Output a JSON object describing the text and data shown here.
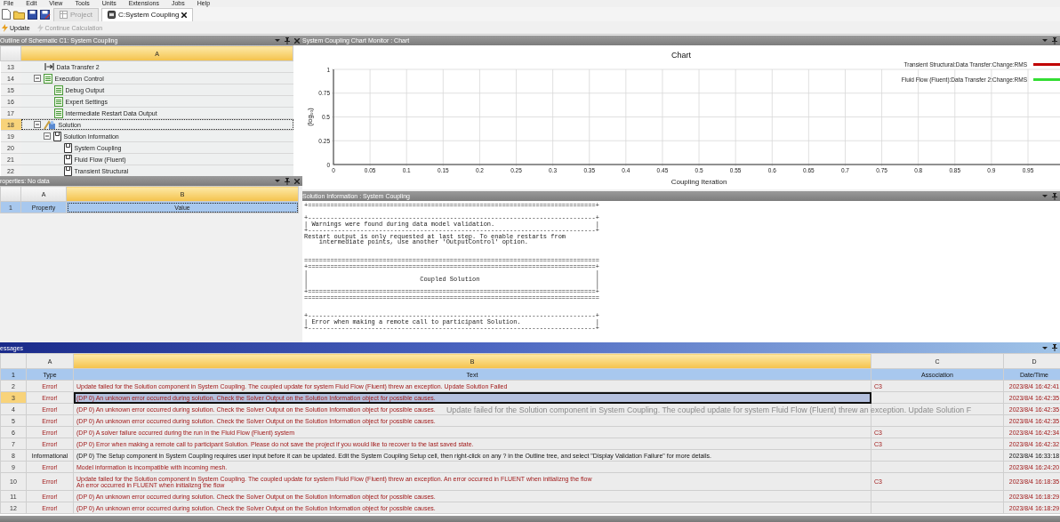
{
  "menu": [
    "File",
    "Edit",
    "View",
    "Tools",
    "Units",
    "Extensions",
    "Jobs",
    "Help"
  ],
  "tabs": [
    {
      "label": "Project",
      "selected": false
    },
    {
      "label": "C:System Coupling",
      "selected": true
    }
  ],
  "toolbar": [
    {
      "label": "Update",
      "disabled": false
    },
    {
      "label": "Continue Calculation",
      "disabled": true
    }
  ],
  "outline": {
    "title": "Outline of Schematic C1: System Coupling",
    "columns": [
      {
        "letter": "A",
        "selected": true
      }
    ],
    "items": [
      {
        "row": "13",
        "label": "Data Transfer 2",
        "kind": "transfer",
        "selected": false
      },
      {
        "row": "14",
        "label": "Execution Control",
        "kind": "settings",
        "expanded": true,
        "selected": false,
        "children": [
          {
            "row": "15",
            "label": "Debug Output",
            "kind": "settings",
            "selected": false
          },
          {
            "row": "16",
            "label": "Expert Settings",
            "kind": "settings",
            "selected": false
          },
          {
            "row": "17",
            "label": "Intermediate Restart Data Output",
            "kind": "settings",
            "selected": false
          }
        ]
      },
      {
        "row": "18",
        "label": "Solution",
        "kind": "solution",
        "expanded": true,
        "selected": true,
        "children": [
          {
            "row": "19",
            "label": "Solution Information",
            "kind": "info",
            "expanded": true,
            "selected": false,
            "children": [
              {
                "row": "20",
                "label": "System Coupling",
                "kind": "info",
                "selected": false
              },
              {
                "row": "21",
                "label": "Fluid Flow (Fluent)",
                "kind": "info",
                "selected": false
              },
              {
                "row": "22",
                "label": "Transient Structural",
                "kind": "info",
                "selected": false
              }
            ]
          }
        ]
      }
    ]
  },
  "properties": {
    "title": "roperties: No data",
    "columns": [
      {
        "letter": "A",
        "selected": false
      },
      {
        "letter": "B",
        "selected": true
      }
    ],
    "rows": [
      {
        "row": "1",
        "cells": [
          "Property",
          "Value"
        ],
        "selected": true
      }
    ]
  },
  "chart_panel": {
    "title": "System Coupling Chart Monitor : Chart",
    "chart_data": {
      "type": "line",
      "title": "Chart",
      "xlabel": "Coupling Iteration",
      "ylabel": "(log₁₀)",
      "categories": [
        "0",
        "0.05",
        "0.1",
        "0.15",
        "0.2",
        "0.25",
        "0.3",
        "0.35",
        "0.4",
        "0.45",
        "0.5",
        "0.55",
        "0.6",
        "0.65",
        "0.7",
        "0.75",
        "0.8",
        "0.85",
        "0.9",
        "0.95"
      ],
      "grid": true,
      "ylim": [
        0,
        1
      ],
      "yticks": [
        0,
        0.25,
        0.5,
        0.75,
        1
      ],
      "series": [
        {
          "name": "Transient Structural:Data Transfer:Change:RMS",
          "color": "#c00000",
          "values": [
            null,
            null,
            null,
            null,
            null,
            null,
            null,
            null,
            null,
            null,
            null,
            null,
            null,
            null,
            null,
            null,
            null,
            null,
            null,
            null
          ]
        },
        {
          "name": "Fluid Flow (Fluent):Data Transfer 2:Change:RMS",
          "color": "#33dd33",
          "values": [
            null,
            null,
            null,
            null,
            null,
            null,
            null,
            null,
            null,
            null,
            null,
            null,
            null,
            null,
            null,
            null,
            null,
            null,
            null,
            null
          ]
        }
      ]
    }
  },
  "solution_info": {
    "title": "Solution Information : System Coupling",
    "log": "+=============================================================================+\n\n+-----------------------------------------------------------------------------+\n| Warnings were found during data model validation.                           |\n+-----------------------------------------------------------------------------+\nRestart output is only requested at last step. To enable restarts from\n    intermediate points, use another 'OutputControl' option.\n\n\n===============================================================================\n+=============================================================================+\n|                                                                             |\n|                              Coupled Solution                               |\n|                                                                             |\n+=============================================================================+\n===============================================================================\n\n\n+-----------------------------------------------------------------------------+\n| Error when making a remote call to participant Solution.                    |\n+-----------------------------------------------------------------------------+"
  },
  "messages": {
    "title": "essages",
    "columns": [
      {
        "letter": "A",
        "selected": false
      },
      {
        "letter": "B",
        "selected": true
      },
      {
        "letter": "C",
        "selected": false
      },
      {
        "letter": "D",
        "selected": false
      }
    ],
    "header": {
      "row": "1",
      "cells": [
        "Type",
        "Text",
        "Association",
        "Date/Time"
      ]
    },
    "rows": [
      {
        "row": "2",
        "kind": "error",
        "type": "Error!",
        "text": [
          "Update failed for the Solution component in System Coupling. The coupled update for system Fluid Flow (Fluent) threw an exception. Update Solution Failed"
        ],
        "association": "C3",
        "time": "2023/8/4 16:42:41",
        "selected": false
      },
      {
        "row": "3",
        "kind": "error",
        "type": "Error!",
        "text": [
          "(DP 0) An unknown error occurred during solution. Check the Solver Output on the Solution Information object for possible causes."
        ],
        "time": "2023/8/4 16:42:35",
        "selected": true
      },
      {
        "row": "4",
        "kind": "error",
        "type": "Error!",
        "text": [
          "(DP 0) An unknown error occurred during solution. Check the Solver Output on the Solution Information object for possible causes."
        ],
        "time": "2023/8/4 16:42:35",
        "selected": false
      },
      {
        "row": "5",
        "kind": "error",
        "type": "Error!",
        "text": [
          "(DP 0) An unknown error occurred during solution. Check the Solver Output on the Solution Information object for possible causes."
        ],
        "time": "2023/8/4 16:42:35",
        "selected": false
      },
      {
        "row": "6",
        "kind": "error",
        "type": "Error!",
        "text": [
          "(DP 0) A solver failure occurred during the run in the Fluid Flow (Fluent) system"
        ],
        "association": "C3",
        "time": "2023/8/4 16:42:34",
        "selected": false
      },
      {
        "row": "7",
        "kind": "error",
        "type": "Error!",
        "text": [
          "(DP 0) Error when making a remote call to participant Solution. Please do not save the project if you would like to recover to the last saved state."
        ],
        "association": "C3",
        "time": "2023/8/4 16:42:32",
        "selected": false
      },
      {
        "row": "8",
        "kind": "info",
        "type": "Informational",
        "text": [
          "(DP 0) The Setup component in System Coupling requires user input before it can be updated. Edit the System Coupling Setup cell, then right-click on any ? in the Outline tree, and select \"Display Validation Failure\" for more details."
        ],
        "time": "2023/8/4 16:33:18",
        "selected": false
      },
      {
        "row": "9",
        "kind": "error",
        "type": "Error!",
        "text": [
          "Model information is incompatible with incoming mesh."
        ],
        "time": "2023/8/4 16:24:20",
        "selected": false
      },
      {
        "row": "10",
        "kind": "error",
        "type": "Error!",
        "text": [
          "Update failed for the Solution component in System Coupling. The coupled update for system Fluid Flow (Fluent) threw an exception. An error occurred in FLUENT when initializng the flow",
          "An error occurred in FLUENT when initializng the flow"
        ],
        "association": "C3",
        "time": "2023/8/4 16:18:35",
        "selected": false
      },
      {
        "row": "11",
        "kind": "error",
        "type": "Error!",
        "text": [
          "(DP 0) An unknown error occurred during solution. Check the Solver Output on the Solution Information object for possible causes."
        ],
        "time": "2023/8/4 16:18:29",
        "selected": false
      },
      {
        "row": "12",
        "kind": "error",
        "type": "Error!",
        "text": [
          "(DP 0) An unknown error occurred during solution. Check the Solver Output on the Solution Information object for possible causes."
        ],
        "time": "2023/8/4 16:18:29",
        "selected": false
      }
    ],
    "tooltip": "Update failed for the Solution component in System Coupling.  The coupled update for system Fluid Flow (Fluent) threw an exception. Update Solution F"
  }
}
